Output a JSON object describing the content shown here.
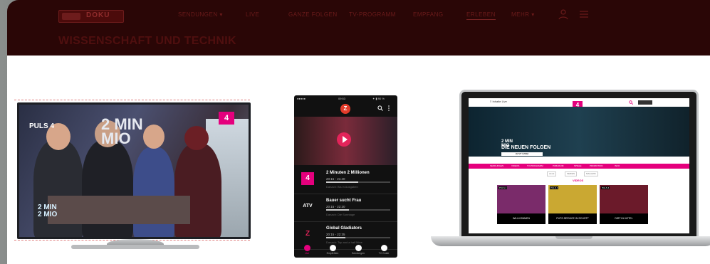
{
  "nav": {
    "logo_label": "DOKU",
    "items": [
      "SENDUNGEN ▾",
      "LIVE",
      "GANZE FOLGEN",
      "TV-PROGRAMM",
      "EMPFANG",
      "ERLEBEN",
      "MEHR ▾"
    ],
    "active_index": 5
  },
  "page_title": "WISSENSCHAFT UND TECHNIK",
  "tv": {
    "channel_label": "PULS 4",
    "show_title_big": "2 MIN\nMIO",
    "show_title_small": "2 MIN\n2 MIO",
    "badge": "4"
  },
  "phone": {
    "status_carrier": "●●●●● ",
    "status_time": "09:53",
    "status_right": "✦ ▮ 90 %",
    "logo": "Z",
    "rows": [
      {
        "channel": "4",
        "channel_color": "#e5007d",
        "show": "2 Minuten 2 Millionen",
        "time": "20:15 - 21:40",
        "next": "Danach: Bis in Ausgaben",
        "progress": 0.5
      },
      {
        "channel": "ATV",
        "channel_color": "#111111",
        "show": "Bauer sucht Frau",
        "time": "20:15 - 22:20",
        "next": "Danach: Die Sonntage",
        "progress": 0.35
      },
      {
        "channel": "Z",
        "channel_color": "#e3245a",
        "show": "Global Gladiators",
        "time": "20:15 - 22:35",
        "next": "Danach: Top and a half Mine",
        "progress": 0.3
      }
    ],
    "tabs": [
      {
        "label": "Live"
      },
      {
        "label": "Empfehlen"
      },
      {
        "label": "Sendungen"
      },
      {
        "label": "TV Guide"
      }
    ],
    "active_tab": 0
  },
  "laptop": {
    "menu_label": "≡  Inhalte    Live",
    "logo": "4",
    "hero_show": "2 MIN\nMIO",
    "hero_title": "DIE NEUEN FOLGEN",
    "cta": "JETZT DABEI",
    "nav_items": [
      "SENDUNGEN",
      "VIDEOS",
      "TV-PROGRAMM",
      "PUBLIKUM",
      "SPIELE",
      "PROMOTION",
      "INFO"
    ],
    "pills": [
      "ALLE",
      "SERIEN",
      "MAGAZIN"
    ],
    "section_title": "VIDEOS",
    "cards": [
      {
        "tag": "PULS 4",
        "caption": "WILLKOMMEN",
        "color": "#7a2b6a"
      },
      {
        "tag": "PULS 4",
        "caption": "PUTZ-SERVICE IN SCHOTT",
        "color": "#caa832"
      },
      {
        "tag": "PULS 4",
        "caption": "DIRT IN HOTEL",
        "color": "#6b1a2a"
      }
    ]
  }
}
